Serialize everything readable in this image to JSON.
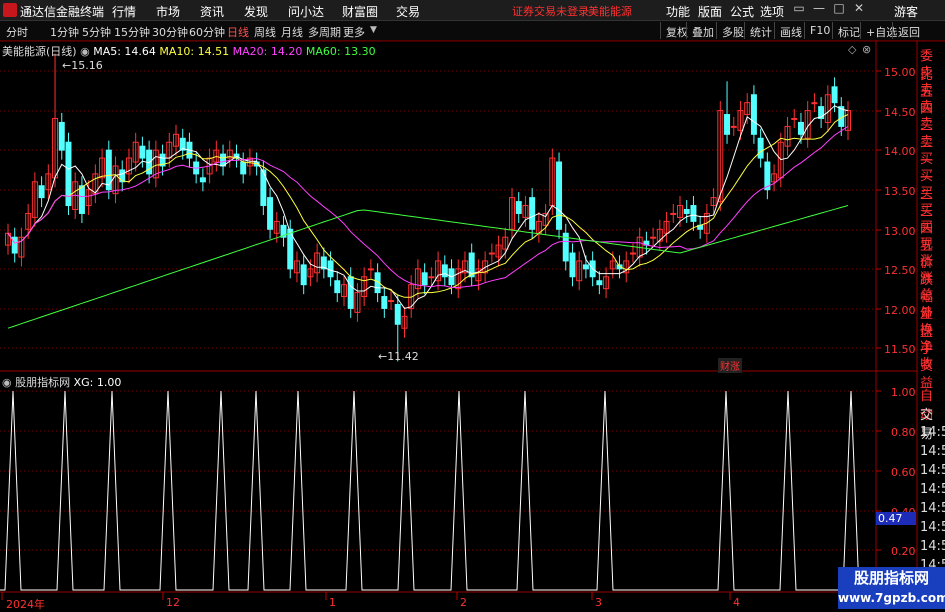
{
  "app": {
    "title": "通达信金融终端",
    "menu": [
      "行情",
      "市场",
      "资讯",
      "发现",
      "问小达",
      "财富圈",
      "交易"
    ],
    "status_warning": "证券交易未登录",
    "stock_name_top": "美能能源",
    "right_menu": [
      "功能",
      "版面",
      "公式",
      "选项"
    ],
    "user": "游客",
    "win_buttons": [
      "▭",
      "—",
      "□",
      "✕"
    ]
  },
  "toolbar": {
    "periods": [
      "分时",
      "1分钟",
      "5分钟",
      "15分钟",
      "30分钟",
      "60分钟",
      "日线",
      "周线",
      "月线",
      "多周期",
      "更多"
    ],
    "active_period": "日线",
    "buttons": [
      "复权",
      "叠加",
      "多股",
      "统计",
      "画线",
      "F10",
      "标记",
      "+自选",
      "返回"
    ]
  },
  "main_chart": {
    "title": "美能能源(日线)",
    "ma": [
      {
        "label": "MA5: 14.64",
        "color": "#ffffff"
      },
      {
        "label": "MA10: 14.51",
        "color": "#ffff40"
      },
      {
        "label": "MA20: 14.20",
        "color": "#ff40ff"
      },
      {
        "label": "MA60: 13.30",
        "color": "#40ff40"
      }
    ],
    "high_label": "15.16",
    "low_label": "11.42",
    "y_ticks": [
      "15.00",
      "14.50",
      "14.00",
      "13.50",
      "13.00",
      "12.50",
      "12.00",
      "11.50"
    ],
    "badge": "财涨"
  },
  "indicator": {
    "title": "股朋指标网",
    "xg_label": "XG: 1.00",
    "y_ticks": [
      "1.00",
      "0.80",
      "0.60",
      "0.40",
      "0.20"
    ],
    "cursor_value": "0.47",
    "spikes_at": [
      13,
      65,
      112,
      168,
      221,
      256,
      298,
      354,
      406,
      459,
      525,
      605,
      726,
      788,
      851
    ]
  },
  "date_axis": [
    "2024年",
    "12",
    "1",
    "2",
    "3",
    "4"
  ],
  "side_panel": {
    "quote_labels": [
      "委比",
      "卖五",
      "卖四",
      "卖三",
      "卖二",
      "卖一",
      "买一",
      "买二",
      "买三",
      "买四",
      "买五",
      "现价",
      "涨跌",
      "涨幅",
      "总量",
      "外盘",
      "换手",
      "净资",
      "收益"
    ],
    "auto_labels": [
      "自动",
      "交易"
    ],
    "times": [
      "14:56",
      "14:56",
      "14:56",
      "14:56",
      "14:56",
      "14:56",
      "14:56",
      "14:56",
      "14:56"
    ]
  },
  "watermark": {
    "line1": "股朋指标网",
    "line2": "www.7gpzb.com"
  },
  "colors": {
    "up": "#ff3030",
    "down": "#54ffff",
    "ma5": "#ffffff",
    "ma10": "#ffff40",
    "ma20": "#ff40ff",
    "ma60": "#40ff40",
    "grid": "#7a0000"
  }
}
